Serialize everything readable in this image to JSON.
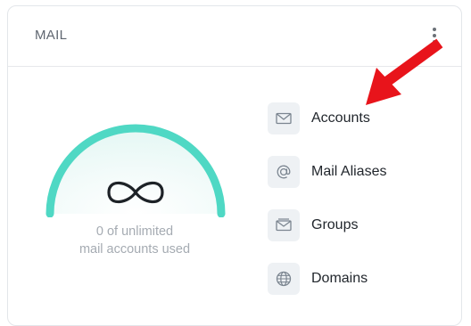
{
  "card": {
    "title": "MAIL"
  },
  "usage": {
    "used_count": 0,
    "limit": "unlimited",
    "line1": "0 of unlimited",
    "line2": "mail accounts used",
    "gauge_color": "#4fd8c4",
    "gauge_symbol": "infinity-icon"
  },
  "menu": {
    "items": [
      {
        "label": "Accounts",
        "icon": "mail-icon"
      },
      {
        "label": "Mail Aliases",
        "icon": "at-sign-icon"
      },
      {
        "label": "Groups",
        "icon": "mail-stack-icon"
      },
      {
        "label": "Domains",
        "icon": "globe-icon"
      }
    ]
  },
  "annotation": {
    "arrow_color": "#e8141b",
    "points_to": "Accounts"
  }
}
